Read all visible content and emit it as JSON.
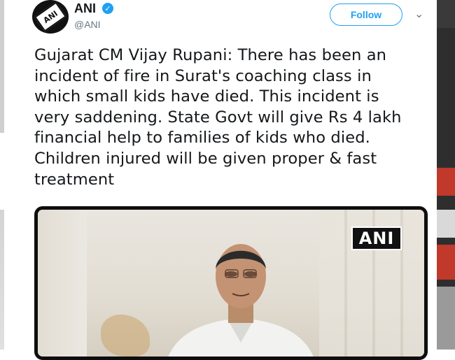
{
  "tweet": {
    "author_name": "ANI",
    "author_handle": "@ANI",
    "avatar_logo_text": "ANI",
    "follow_label": "Follow",
    "caret_glyph": "⌄",
    "verified_glyph": "✓",
    "text_lines": [
      "Gujarat CM Vijay Rupani: There has been an",
      "incident of fire in Surat's coaching class in",
      "which small kids have died. This incident is",
      "very saddening. State Govt will give Rs 4 lakh",
      "financial help to families of kids who died.",
      "Children injured will be given proper & fast",
      "treatment"
    ],
    "media": {
      "watermark": "ANI"
    }
  },
  "colors": {
    "accent": "#1da1f2",
    "text": "#14171a",
    "muted": "#657786"
  },
  "icons": {
    "verified": "verified-badge-icon",
    "caret": "chevron-down-icon"
  }
}
